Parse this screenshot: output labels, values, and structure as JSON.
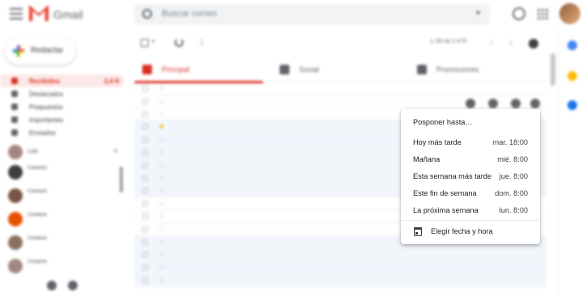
{
  "header": {
    "brand": "Gmail",
    "search_placeholder": "Buscar correo"
  },
  "compose_label": "Redactar",
  "nav": [
    {
      "label": "Recibidos",
      "count": "2,4 K",
      "active": true
    },
    {
      "label": "Destacados",
      "count": ""
    },
    {
      "label": "Pospuestos",
      "count": ""
    },
    {
      "label": "Importantes",
      "count": ""
    },
    {
      "label": "Enviados",
      "count": ""
    }
  ],
  "hangouts": {
    "me": "Luis",
    "contacts": [
      {
        "name": "Contacto",
        "status": "",
        "color": "#3c4043"
      },
      {
        "name": "Contacto",
        "status": "",
        "color": "#795548"
      },
      {
        "name": "Contacto",
        "status": "",
        "color": "#e65100"
      },
      {
        "name": "Contacto",
        "status": "",
        "color": "#8d6e63"
      },
      {
        "name": "Contacto",
        "status": "",
        "color": "#a1887f"
      }
    ]
  },
  "toolbar": {
    "pager": "1–50 de 2.470"
  },
  "tabs": [
    {
      "label": "Principal",
      "active": true,
      "icon": "inbox-icon",
      "color": "#d93025"
    },
    {
      "label": "Social",
      "active": false,
      "icon": "people-icon",
      "color": "#5f6368"
    },
    {
      "label": "Promociones",
      "active": false,
      "icon": "tag-icon",
      "color": "#5f6368"
    }
  ],
  "emails": [
    {
      "from": "",
      "subject": "",
      "date": "",
      "unread": true,
      "starred": false
    },
    {
      "from": "",
      "subject": "",
      "date": "",
      "unread": true,
      "starred": false
    },
    {
      "from": "",
      "subject": "",
      "date": "",
      "unread": true,
      "starred": false
    },
    {
      "from": "",
      "subject": "",
      "date": "",
      "unread": false,
      "starred": true
    },
    {
      "from": "",
      "subject": "",
      "date": "",
      "unread": false,
      "starred": false
    },
    {
      "from": "",
      "subject": "",
      "date": "",
      "unread": false,
      "starred": false
    },
    {
      "from": "",
      "subject": "",
      "date": "",
      "unread": false,
      "starred": false
    },
    {
      "from": "",
      "subject": "",
      "date": "",
      "unread": false,
      "starred": false
    },
    {
      "from": "",
      "subject": "",
      "date": "",
      "unread": false,
      "starred": false
    },
    {
      "from": "",
      "subject": "",
      "date": "",
      "unread": true,
      "starred": false
    },
    {
      "from": "",
      "subject": "",
      "date": "",
      "unread": true,
      "starred": false
    },
    {
      "from": "",
      "subject": "",
      "date": "",
      "unread": true,
      "starred": false
    },
    {
      "from": "",
      "subject": "",
      "date": "",
      "unread": false,
      "starred": false
    },
    {
      "from": "",
      "subject": "",
      "date": "",
      "unread": false,
      "starred": false
    },
    {
      "from": "",
      "subject": "",
      "date": "",
      "unread": false,
      "starred": false
    },
    {
      "from": "",
      "subject": "",
      "date": "",
      "unread": false,
      "starred": false
    }
  ],
  "snooze_menu": {
    "title": "Posponer hasta…",
    "options": [
      {
        "label": "Hoy más tarde",
        "time": "mar. 18:00"
      },
      {
        "label": "Mañana",
        "time": "mié. 8:00"
      },
      {
        "label": "Esta semana más tarde",
        "time": "jue. 8:00"
      },
      {
        "label": "Este fin de semana",
        "time": "dom. 8:00"
      },
      {
        "label": "La próxima semana",
        "time": "lun. 8:00"
      }
    ],
    "pick_label": "Elegir fecha y hora"
  },
  "colors": {
    "accent": "#d93025",
    "star": "#f4b400"
  }
}
